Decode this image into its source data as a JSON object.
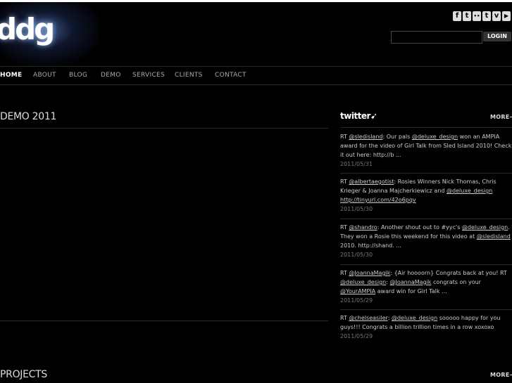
{
  "header": {
    "logo_text": "ddg",
    "social": [
      {
        "name": "facebook",
        "glyph": "f"
      },
      {
        "name": "twitter",
        "glyph": "t"
      },
      {
        "name": "flickr",
        "glyph": "••"
      },
      {
        "name": "tumblr",
        "glyph": "t"
      },
      {
        "name": "vimeo",
        "glyph": "v"
      },
      {
        "name": "youtube",
        "glyph": "▶"
      }
    ],
    "search_value": "",
    "login_label": "LOGIN"
  },
  "nav": {
    "home": "HOME",
    "about": "ABOUT",
    "blog": "BLOG",
    "demo": "DEMO",
    "services": "SERVICES",
    "clients": "CLIENTS",
    "contact": "CONTACT"
  },
  "main": {
    "demo_title": "DEMO 2011",
    "projects_title": "PROJECTS",
    "projects_more": "MORE"
  },
  "twitter": {
    "heading": "twitter",
    "more_label": "MORE",
    "tweets": [
      {
        "a": "RT ",
        "m1": "@sledisland",
        "b": ": Our pals ",
        "m2": "@deluxe_design",
        "c": " won an AMPIA award for the video of Girl Talk from Sled Island 2010! Check it out here: http://b ...",
        "date": "2011/05/31"
      },
      {
        "a": "RT ",
        "m1": "@albertaegotist",
        "b": ": Rosies Winners Nick Thomas, Chris Krieger & Joanna Majcherkiewicz and ",
        "m2": "@deluxe_design",
        "m3": "http://tinyurl.com/42o6pqv",
        "date": "2011/05/30"
      },
      {
        "a": "RT ",
        "m1": "@shandro",
        "b": ": Another shout out to #yyc's ",
        "m2": "@deluxe_design",
        "c": ". They won a Rosie this weekend for this video at ",
        "m3": "@sledisland",
        "d": " 2010. http://shand. ...",
        "date": "2011/05/30"
      },
      {
        "a": "RT ",
        "m1": "@JoannaMagik",
        "b": ": {Air hoooorn} Congrats back at you! RT ",
        "m2": "@deluxe_design",
        "c": ": ",
        "m3": "@JoannaMagik",
        "d": " congrats on your ",
        "m4": "@YourAMPIA",
        "e": " award win for Girl Talk ...",
        "date": "2011/05/29"
      },
      {
        "a": "RT ",
        "m1": "@chelseasiler",
        "b": ": ",
        "m2": "@deluxe_design",
        "c": " sooooo happy for you guys!!! Congrats a billion trillion times in a row xoxoxo",
        "date": "2011/05/29"
      }
    ]
  }
}
